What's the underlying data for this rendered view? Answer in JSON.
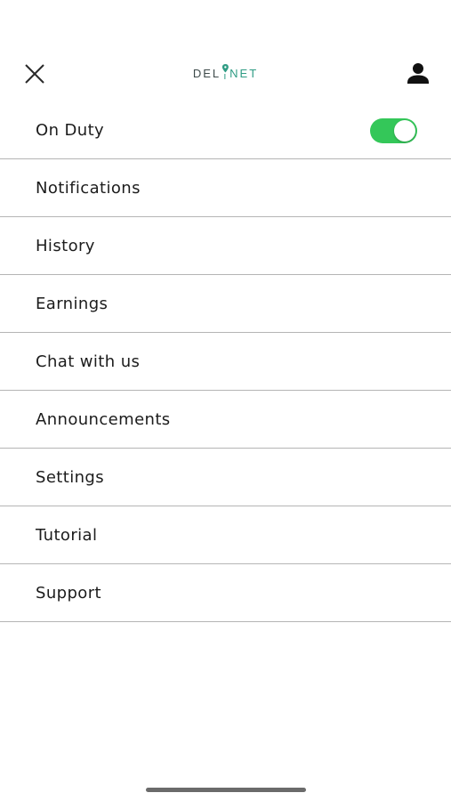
{
  "header": {
    "close_icon": "close-icon",
    "logo": {
      "part_left": "DEL",
      "part_right": "NET",
      "icon": "location-pin-icon",
      "color_left": "#3d4a4a",
      "color_accent": "#2f9c84"
    },
    "profile_icon": "person-icon"
  },
  "menu": {
    "on_duty": {
      "label": "On Duty",
      "toggle_on": true,
      "toggle_color": "#34c759"
    },
    "items": [
      {
        "label": "Notifications"
      },
      {
        "label": "History"
      },
      {
        "label": "Earnings"
      },
      {
        "label": "Chat with us"
      },
      {
        "label": "Announcements"
      },
      {
        "label": "Settings"
      },
      {
        "label": "Tutorial"
      },
      {
        "label": "Support"
      }
    ]
  }
}
